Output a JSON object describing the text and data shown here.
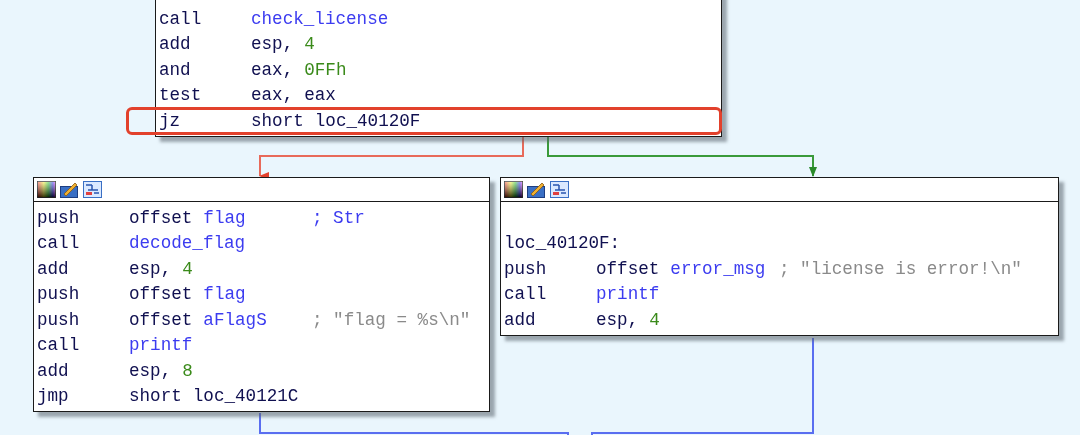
{
  "blocks": [
    {
      "header": false,
      "lines": [
        {
          "kind": "instr",
          "mnemonic": "call",
          "operands": [
            {
              "text": "check_license",
              "kind": "name"
            }
          ]
        },
        {
          "kind": "instr",
          "mnemonic": "add",
          "operands": [
            {
              "text": "esp,",
              "kind": "reg"
            },
            {
              "text": "4",
              "kind": "number"
            }
          ]
        },
        {
          "kind": "instr",
          "mnemonic": "and",
          "operands": [
            {
              "text": "eax,",
              "kind": "reg"
            },
            {
              "text": "0FFh",
              "kind": "number"
            }
          ]
        },
        {
          "kind": "instr",
          "mnemonic": "test",
          "operands": [
            {
              "text": "eax,",
              "kind": "reg"
            },
            {
              "text": "eax",
              "kind": "reg"
            }
          ]
        },
        {
          "kind": "instr",
          "mnemonic": "jz",
          "highlighted": true,
          "operands": [
            {
              "text": "short",
              "kind": "reg"
            },
            {
              "text": "loc_40120F",
              "kind": "reg"
            }
          ]
        }
      ]
    },
    {
      "header": true,
      "lines": [
        {
          "kind": "instr",
          "mnemonic": "push",
          "operands": [
            {
              "text": "offset",
              "kind": "reg"
            },
            {
              "text": "flag",
              "kind": "name"
            }
          ],
          "comment": {
            "text": "; Str",
            "kind": "name"
          }
        },
        {
          "kind": "instr",
          "mnemonic": "call",
          "operands": [
            {
              "text": "decode_flag",
              "kind": "name"
            }
          ]
        },
        {
          "kind": "instr",
          "mnemonic": "add",
          "operands": [
            {
              "text": "esp,",
              "kind": "reg"
            },
            {
              "text": "4",
              "kind": "number"
            }
          ]
        },
        {
          "kind": "instr",
          "mnemonic": "push",
          "operands": [
            {
              "text": "offset",
              "kind": "reg"
            },
            {
              "text": "flag",
              "kind": "name"
            }
          ]
        },
        {
          "kind": "instr",
          "mnemonic": "push",
          "operands": [
            {
              "text": "offset",
              "kind": "reg"
            },
            {
              "text": "aFlagS",
              "kind": "name"
            }
          ],
          "comment": {
            "text": "; \"flag = %s\\n\"",
            "kind": "string"
          }
        },
        {
          "kind": "instr",
          "mnemonic": "call",
          "operands": [
            {
              "text": "printf",
              "kind": "name"
            }
          ]
        },
        {
          "kind": "instr",
          "mnemonic": "add",
          "operands": [
            {
              "text": "esp,",
              "kind": "reg"
            },
            {
              "text": "8",
              "kind": "number"
            }
          ]
        },
        {
          "kind": "instr",
          "mnemonic": "jmp",
          "operands": [
            {
              "text": "short",
              "kind": "reg"
            },
            {
              "text": "loc_40121C",
              "kind": "reg"
            }
          ]
        }
      ]
    },
    {
      "header": true,
      "lines": [
        {
          "kind": "blank"
        },
        {
          "kind": "label",
          "text": "loc_40120F:"
        },
        {
          "kind": "instr",
          "mnemonic": "push",
          "operands": [
            {
              "text": "offset",
              "kind": "reg"
            },
            {
              "text": "error_msg",
              "kind": "name"
            }
          ],
          "comment": {
            "text": "; \"license is error!\\n\"",
            "kind": "string"
          }
        },
        {
          "kind": "instr",
          "mnemonic": "call",
          "operands": [
            {
              "text": "printf",
              "kind": "name"
            }
          ]
        },
        {
          "kind": "instr",
          "mnemonic": "add",
          "operands": [
            {
              "text": "esp,",
              "kind": "reg"
            },
            {
              "text": "4",
              "kind": "number"
            }
          ]
        }
      ]
    }
  ]
}
